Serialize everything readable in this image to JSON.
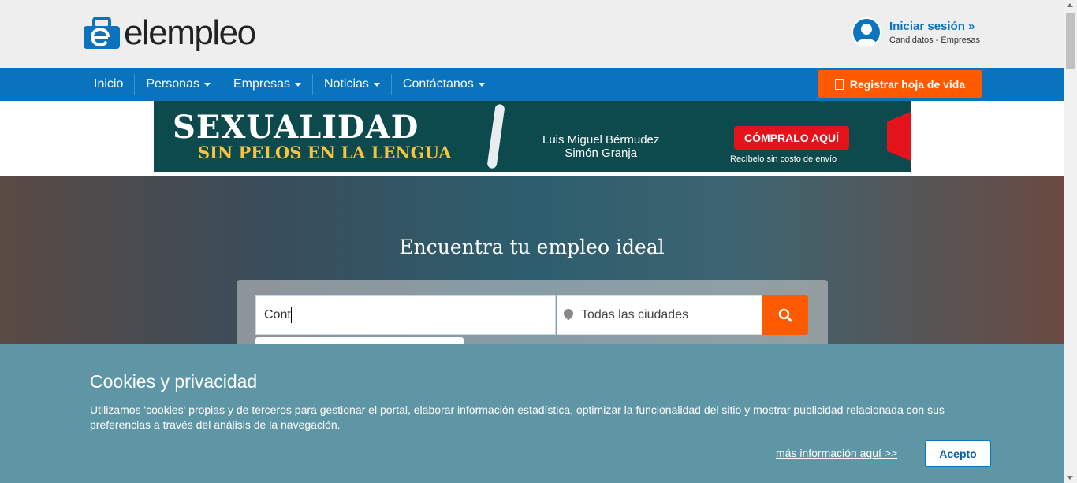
{
  "header": {
    "logo_text": "elempleo",
    "login_title": "Iniciar sesión »",
    "login_sub": "Candidatos - Empresas"
  },
  "nav": {
    "items": [
      {
        "label": "Inicio",
        "dropdown": false
      },
      {
        "label": "Personas",
        "dropdown": true
      },
      {
        "label": "Empresas",
        "dropdown": true
      },
      {
        "label": "Noticias",
        "dropdown": true
      },
      {
        "label": "Contáctanos",
        "dropdown": true
      }
    ],
    "register_label": "Registrar hoja de vida"
  },
  "banner": {
    "title": "SEXUALIDAD",
    "subtitle": "SIN PELOS EN LA LENGUA",
    "author_1": "Luis Miguel Bérmudez",
    "author_2": "Simón Granja",
    "cta": "CÓMPRALO AQUÍ",
    "shipping": "Recíbelo sin costo de envío"
  },
  "hero": {
    "title": "Encuentra tu empleo ideal",
    "search_value": "Cont",
    "city_value": "Todas las ciudades"
  },
  "cookies": {
    "title": "Cookies y privacidad",
    "text": "Utilizamos 'cookies' propias y de terceros para gestionar el portal, elaborar información estadística, optimizar la funcionalidad del sitio y mostrar publicidad relacionada con sus preferencias a través del análisis de la navegación.",
    "more_link": "más información aquí >>",
    "accept": "Acepto"
  },
  "colors": {
    "brand_blue": "#0a73bd",
    "accent_orange": "#ff5a00",
    "cookie_bg": "#5e96a6"
  }
}
